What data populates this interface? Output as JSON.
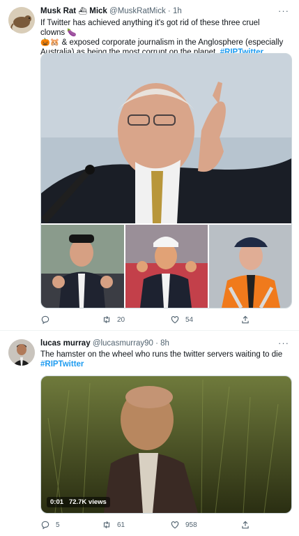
{
  "tweets": [
    {
      "display_name_a": "Musk Rat",
      "display_name_b": "Mick",
      "handle": "@MuskRatMick",
      "dot": "·",
      "time": "1h",
      "text_1": "If Twitter has achieved anything it's got rid of these three cruel clowns ",
      "text_2": " & exposed corporate journalism in the Anglosphere (especially Australia) as being the most corrupt on the planet. ",
      "emoji_eggplant": "🍆",
      "emoji_pumpkin": "🎃🐹",
      "hashtag": "#RIPTwitter",
      "replies": "",
      "retweets": "20",
      "likes": "54"
    },
    {
      "display_name": "lucas murray",
      "handle": "@lucasmurray90",
      "dot": "·",
      "time": "8h",
      "text": "The hamster on the wheel who runs the twitter servers waiting to die",
      "hashtag": "#RIPTwitter",
      "video_time": "0:01",
      "video_views": "72.7K views",
      "replies": "5",
      "retweets": "61",
      "likes": "958"
    }
  ],
  "more_glyph": "···",
  "colors": {
    "accent": "#1d9bf0",
    "muted": "#536471",
    "text": "#0f1419"
  },
  "icons": [
    "reply-icon",
    "retweet-icon",
    "like-icon",
    "share-icon",
    "ship-icon",
    "more-icon"
  ]
}
